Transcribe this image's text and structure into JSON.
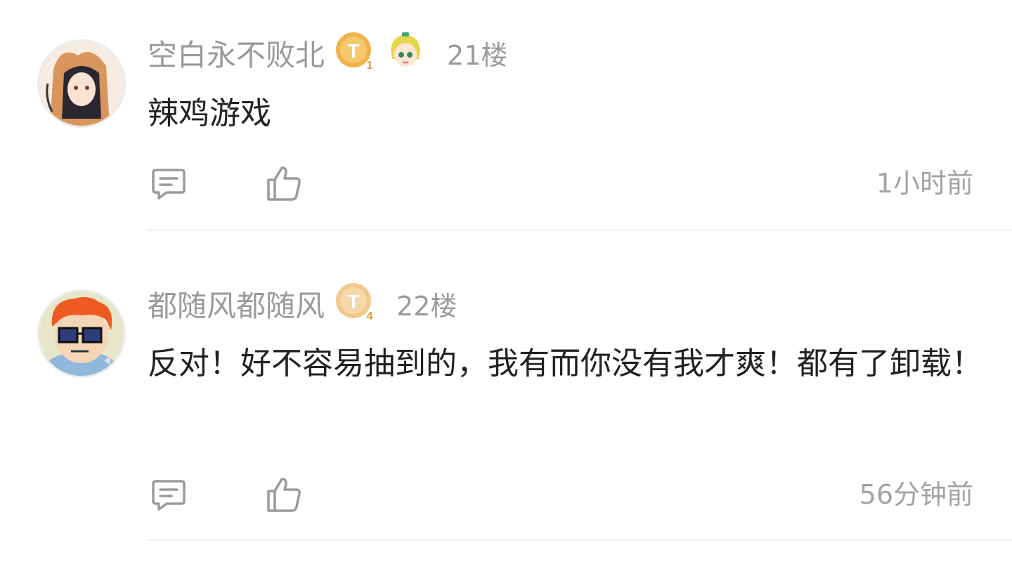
{
  "comments": [
    {
      "username": "空白永不败北",
      "level_badge": "T",
      "level_num": "1",
      "floor": "21楼",
      "content": "辣鸡游戏",
      "time": "1小时前"
    },
    {
      "username": "都随风都随风",
      "level_badge": "T",
      "level_num": "4",
      "floor": "22楼",
      "content": "反对！好不容易抽到的，我有而你没有我才爽！都有了卸载！",
      "time": "56分钟前"
    }
  ],
  "icons": {
    "reply": "comment-icon",
    "like": "thumbs-up-icon"
  },
  "colors": {
    "muted_text": "#9a9a9a",
    "body_text": "#222222",
    "badge_gold": "#f2b24b",
    "badge_light": "#f2c98c",
    "divider": "#f0f0f0"
  }
}
